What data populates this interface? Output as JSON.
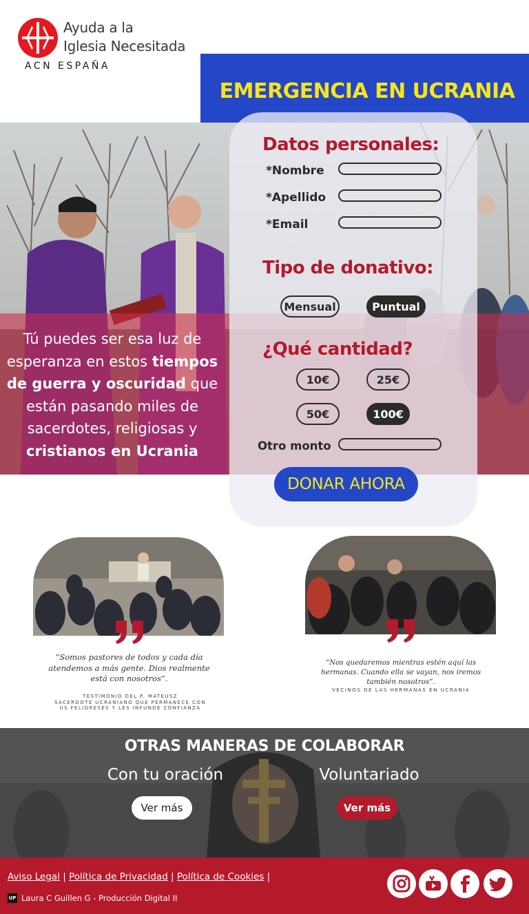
{
  "header": {
    "logo_line1": "Ayuda a la",
    "logo_line2": "Iglesia Necesitada",
    "logo_sub": "ACN ESPAÑA",
    "banner_title": "EMERGENCIA EN UCRANIA"
  },
  "hero": {
    "text_parts": {
      "a": "Tú puedes ser esa luz de esperanza en estos ",
      "b": "tiempos de guerra y oscuridad",
      "c": " que están pasando miles de sacerdotes, religiosas y ",
      "d": "cristianos en Ucrania"
    }
  },
  "form": {
    "personal_heading": "Datos personales:",
    "fields": [
      {
        "label": "*Nombre",
        "value": ""
      },
      {
        "label": "*Apellido",
        "value": ""
      },
      {
        "label": "*Email",
        "value": ""
      }
    ],
    "donation_type_heading": "Tipo de donativo:",
    "donation_types": [
      {
        "label": "Mensual",
        "selected": false
      },
      {
        "label": "Puntual",
        "selected": true
      }
    ],
    "amount_heading": "¿Qué cantidad?",
    "amounts": [
      {
        "label": "10€",
        "selected": false
      },
      {
        "label": "25€",
        "selected": false
      },
      {
        "label": "50€",
        "selected": false
      },
      {
        "label": "100€",
        "selected": true
      }
    ],
    "other_amount_label": "Otro monto",
    "other_amount_value": "",
    "submit_label": "DONAR AHORA"
  },
  "testimonials": [
    {
      "quote": "“Somos pastores de todos y cada día atendemos a más gente. Dios realmente está con nosotros”.",
      "source_line1": "Testimonio del P. Mateusz",
      "source_line2": "sacerdote ucraniano que permanece con",
      "source_line3": "us feligreses y les infunde confianza"
    },
    {
      "quote": "“Nos quedaremos mientras estén aquí las hermanas. Cuando ella se vayan, nos iremos también nosotros”.",
      "source_line1": "Vecinos de las hermanas en Ucrania"
    }
  ],
  "other_ways": {
    "heading": "OTRAS MANERAS DE COLABORAR",
    "items": [
      {
        "title": "Con tu oración",
        "button": "Ver más"
      },
      {
        "title": "Voluntariado",
        "button": "Ver más"
      }
    ]
  },
  "footer": {
    "links": [
      "Aviso Legal",
      "Política de Privacidad",
      "Política de Cookies"
    ],
    "credit": "Laura C Guillen G - Producción Digital II",
    "credit_badge": "UP",
    "social": [
      "instagram-icon",
      "youtube-icon",
      "facebook-icon",
      "twitter-icon"
    ]
  },
  "colors": {
    "brand_red": "#b4192c",
    "brand_blue": "#2347c7",
    "banner_yellow": "#f6e51c",
    "dark_pill": "#2b2b2b"
  }
}
